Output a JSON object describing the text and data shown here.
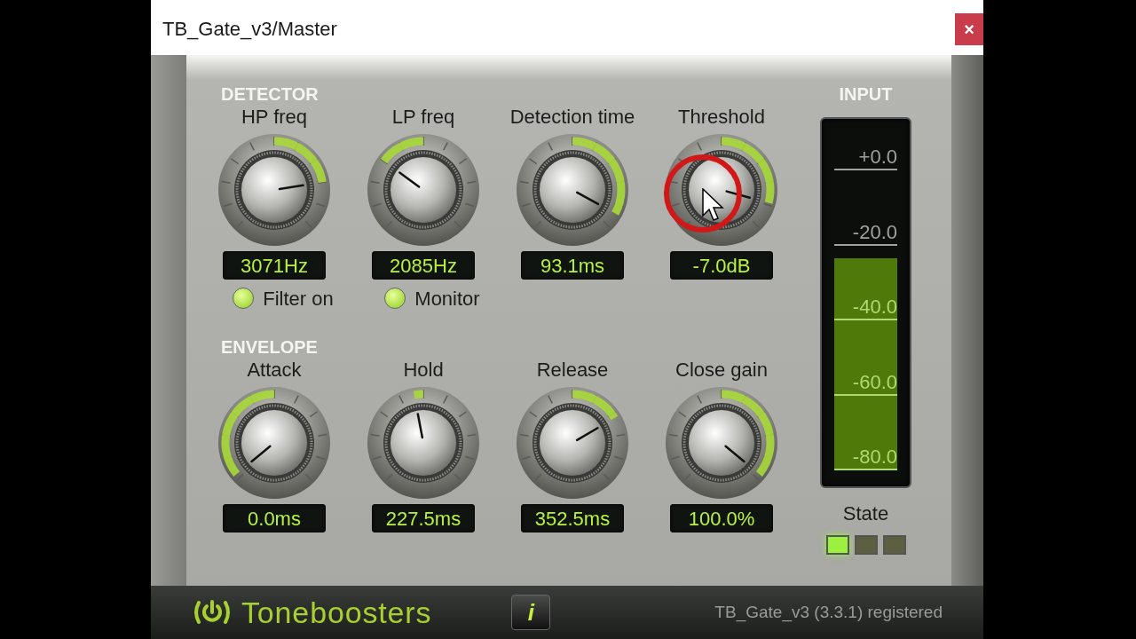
{
  "window": {
    "title": "TB_Gate_v3/Master",
    "close": "×"
  },
  "sections": [
    {
      "title": "DETECTOR",
      "knobs": [
        {
          "label": "HP freq",
          "value": "3071Hz"
        },
        {
          "label": "LP freq",
          "value": "2085Hz"
        },
        {
          "label": "Detection time",
          "value": "93.1ms"
        },
        {
          "label": "Threshold",
          "value": "-7.0dB"
        }
      ],
      "toggles": [
        {
          "label": "Filter on",
          "on": true
        },
        {
          "label": "Monitor",
          "on": true
        }
      ]
    },
    {
      "title": "ENVELOPE",
      "knobs": [
        {
          "label": "Attack",
          "value": "0.0ms"
        },
        {
          "label": "Hold",
          "value": "227.5ms"
        },
        {
          "label": "Release",
          "value": "352.5ms"
        },
        {
          "label": "Close gain",
          "value": "100.0%"
        }
      ]
    }
  ],
  "input": {
    "title": "INPUT",
    "level": 0.64,
    "scale": [
      "+0.0",
      "-20.0",
      "-40.0",
      "-60.0",
      "-80.0"
    ],
    "state_label": "State",
    "state_leds": [
      {
        "on": true
      },
      {
        "on": false
      },
      {
        "on": false
      }
    ]
  },
  "footer": {
    "logo": "Toneboosters",
    "info": "i",
    "version": "TB_Gate_v3 (3.3.1) registered"
  }
}
